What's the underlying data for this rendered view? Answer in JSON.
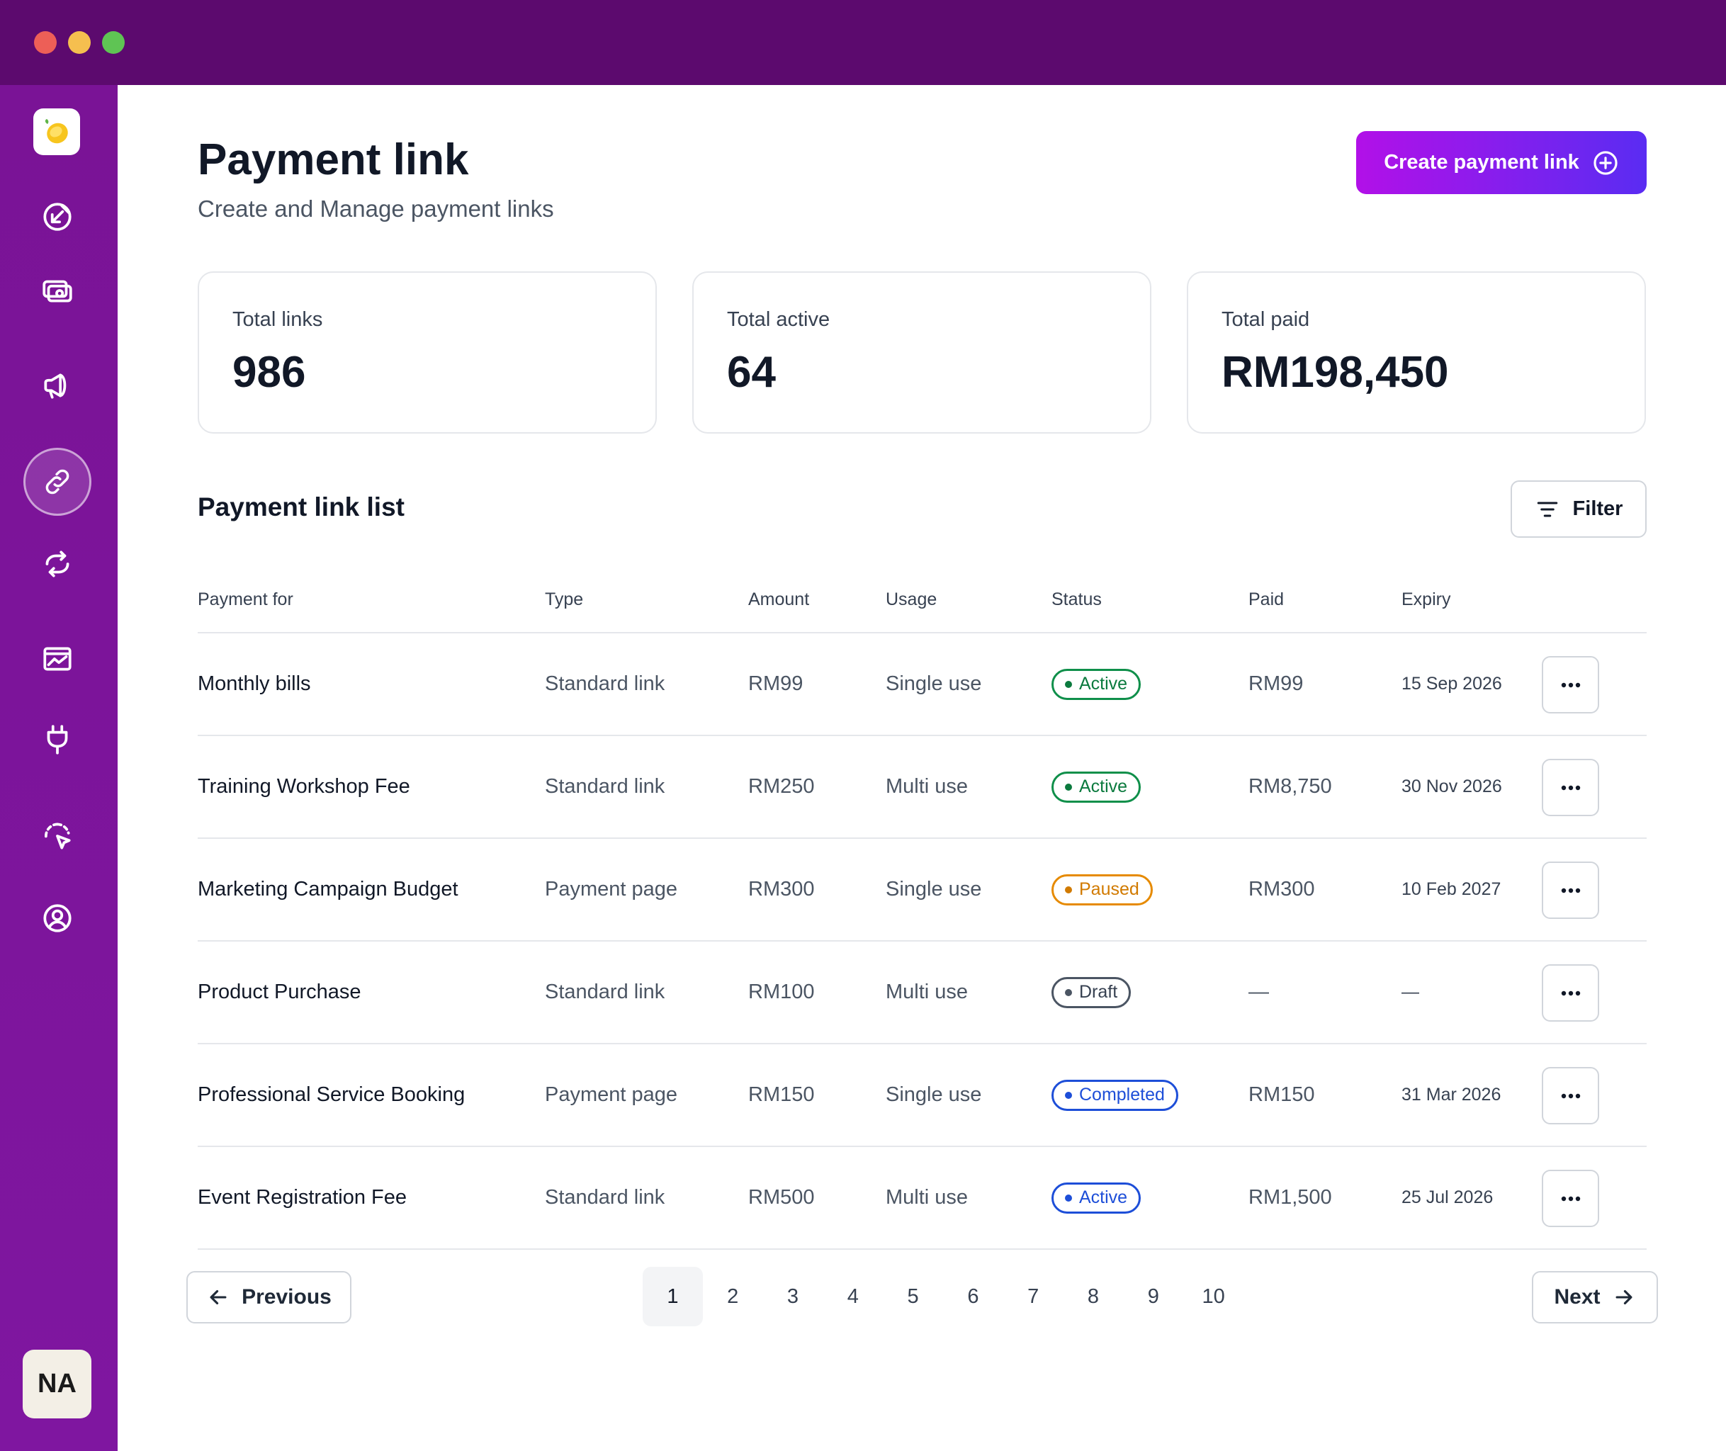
{
  "window": {
    "controls": [
      "close",
      "minimize",
      "maximize"
    ],
    "colors": {
      "titlebar": "#5c0a6e",
      "sidebar": "#7a1396",
      "accent_start": "#b210e8",
      "accent_end": "#5a2cf2"
    }
  },
  "sidebar": {
    "logo_icon": "lemon-icon",
    "items": [
      {
        "icon": "arrow-in-circle-icon",
        "active": false
      },
      {
        "icon": "wallet-icon",
        "active": false
      },
      {
        "icon": "megaphone-icon",
        "active": false
      },
      {
        "icon": "link-icon",
        "active": true
      },
      {
        "icon": "refresh-icon",
        "active": false
      },
      {
        "icon": "chart-card-icon",
        "active": false
      },
      {
        "icon": "plug-icon",
        "active": false
      },
      {
        "icon": "cursor-select-icon",
        "active": false
      },
      {
        "icon": "user-circle-icon",
        "active": false
      }
    ],
    "avatar_initials": "NA"
  },
  "header": {
    "title": "Payment link",
    "subtitle": "Create and Manage payment links",
    "create_button_label": "Create payment link"
  },
  "stats": [
    {
      "label": "Total links",
      "value": "986"
    },
    {
      "label": "Total active",
      "value": "64"
    },
    {
      "label": "Total paid",
      "value": "RM198,450"
    }
  ],
  "list": {
    "title": "Payment link list",
    "filter_label": "Filter",
    "columns": [
      "Payment for",
      "Type",
      "Amount",
      "Usage",
      "Status",
      "Paid",
      "Expiry"
    ],
    "rows": [
      {
        "payment_for": "Monthly bills",
        "type": "Standard link",
        "amount": "RM99",
        "usage": "Single use",
        "status": "Active",
        "status_color": "green",
        "paid": "RM99",
        "expiry": "15 Sep 2026"
      },
      {
        "payment_for": "Training Workshop Fee",
        "type": "Standard link",
        "amount": "RM250",
        "usage": "Multi use",
        "status": "Active",
        "status_color": "green",
        "paid": "RM8,750",
        "expiry": "30 Nov 2026"
      },
      {
        "payment_for": "Marketing Campaign Budget",
        "type": "Payment page",
        "amount": "RM300",
        "usage": "Single use",
        "status": "Paused",
        "status_color": "orange",
        "paid": "RM300",
        "expiry": "10 Feb 2027"
      },
      {
        "payment_for": "Product Purchase",
        "type": "Standard link",
        "amount": "RM100",
        "usage": "Multi use",
        "status": "Draft",
        "status_color": "gray",
        "paid": "—",
        "expiry": "—"
      },
      {
        "payment_for": "Professional Service Booking",
        "type": "Payment page",
        "amount": "RM150",
        "usage": "Single use",
        "status": "Completed",
        "status_color": "blue",
        "paid": "RM150",
        "expiry": "31 Mar 2026"
      },
      {
        "payment_for": "Event Registration Fee",
        "type": "Standard link",
        "amount": "RM500",
        "usage": "Multi use",
        "status": "Active",
        "status_color": "blue",
        "paid": "RM1,500",
        "expiry": "25 Jul 2026"
      }
    ]
  },
  "pagination": {
    "previous_label": "Previous",
    "next_label": "Next",
    "pages": [
      "1",
      "2",
      "3",
      "4",
      "5",
      "6",
      "7",
      "8",
      "9",
      "10"
    ],
    "current_page": "1"
  }
}
